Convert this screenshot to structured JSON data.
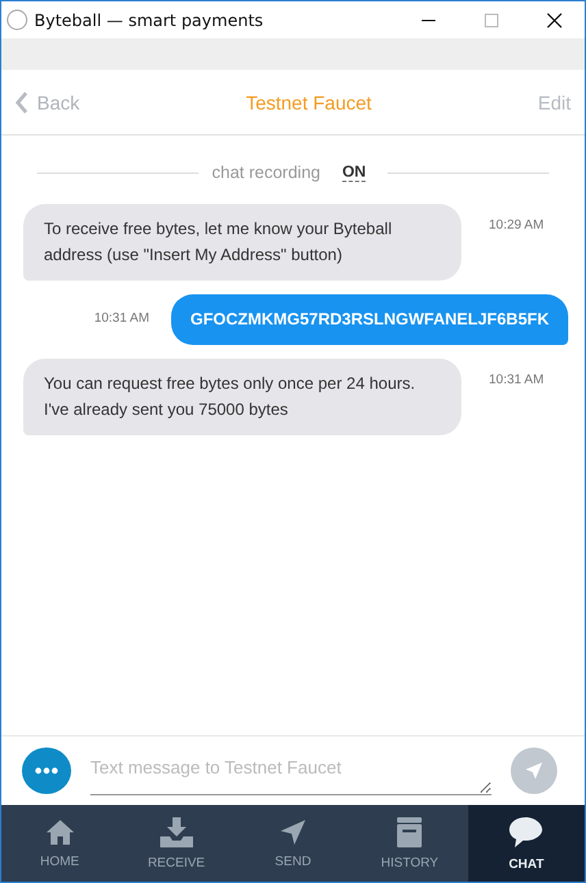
{
  "window": {
    "title": "Byteball — smart payments"
  },
  "header": {
    "back": "Back",
    "title": "Testnet Faucet",
    "edit": "Edit"
  },
  "recording": {
    "label": "chat recording",
    "state": "ON"
  },
  "messages": [
    {
      "kind": "incoming",
      "text": "To receive free bytes, let me know your Byteball address (use \"Insert My Address\" button)",
      "time": "10:29 AM"
    },
    {
      "kind": "outgoing",
      "text": "GFOCZMKMG57RD3RSLNGWFANELJF6B5FK",
      "time": "10:31 AM"
    },
    {
      "kind": "incoming",
      "text": "You can request free bytes only once per 24 hours. I've already sent you 75000 bytes",
      "time": "10:31 AM"
    }
  ],
  "composer": {
    "placeholder": "Text message to Testnet Faucet"
  },
  "tabs": [
    {
      "label": "HOME",
      "selected": false
    },
    {
      "label": "RECEIVE",
      "selected": false
    },
    {
      "label": "SEND",
      "selected": false
    },
    {
      "label": "HISTORY",
      "selected": false
    },
    {
      "label": "CHAT",
      "selected": true
    }
  ]
}
